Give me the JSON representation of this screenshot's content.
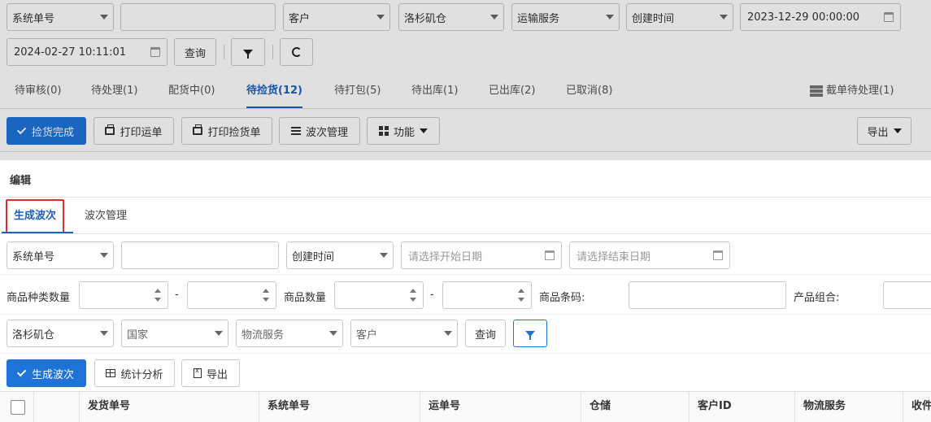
{
  "bg": {
    "filters_row1": [
      {
        "label": "系统单号",
        "type": "select"
      },
      {
        "label": "",
        "type": "input"
      },
      {
        "label": "客户",
        "type": "select"
      },
      {
        "label": "洛杉矶仓",
        "type": "select"
      },
      {
        "label": "运输服务",
        "type": "select"
      },
      {
        "label": "创建时间",
        "type": "select"
      }
    ],
    "date_start": "2023-12-29 00:00:00",
    "date_end": "2024-02-27 10:11:01",
    "query_label": "查询",
    "tabs": [
      {
        "label": "待审核(0)"
      },
      {
        "label": "待处理(1)"
      },
      {
        "label": "配货中(0)"
      },
      {
        "label": "待捡货(12)"
      },
      {
        "label": "待打包(5)"
      },
      {
        "label": "待出库(1)"
      },
      {
        "label": "已出库(2)"
      },
      {
        "label": "已取消(8)"
      }
    ],
    "tab_right": "截单待处理(1)",
    "toolbar": {
      "pick_done": "捡货完成",
      "print_waybill": "打印运单",
      "print_pick": "打印捡货单",
      "wave_manage": "波次管理",
      "functions": "功能",
      "export": "导出"
    }
  },
  "modal": {
    "title": "编辑",
    "tabs": [
      {
        "label": "生成波次"
      },
      {
        "label": "波次管理"
      }
    ],
    "row1": {
      "select1": "系统单号",
      "input1": "",
      "select2": "创建时间",
      "start_placeholder": "请选择开始日期",
      "end_placeholder": "请选择结束日期"
    },
    "row2": {
      "sku_kinds_label": "商品种类数量",
      "dash": "-",
      "qty_label": "商品数量",
      "barcode_label": "商品条码:",
      "combo_label": "产品组合:"
    },
    "row3": {
      "warehouse": "洛杉矶仓",
      "country": "国家",
      "logistics": "物流服务",
      "customer": "客户",
      "query": "查询"
    },
    "toolbar": {
      "generate": "生成波次",
      "stats": "统计分析",
      "export": "导出"
    },
    "table_headers": [
      "发货单号",
      "系统单号",
      "运单号",
      "仓储",
      "客户ID",
      "物流服务",
      "收件"
    ]
  }
}
